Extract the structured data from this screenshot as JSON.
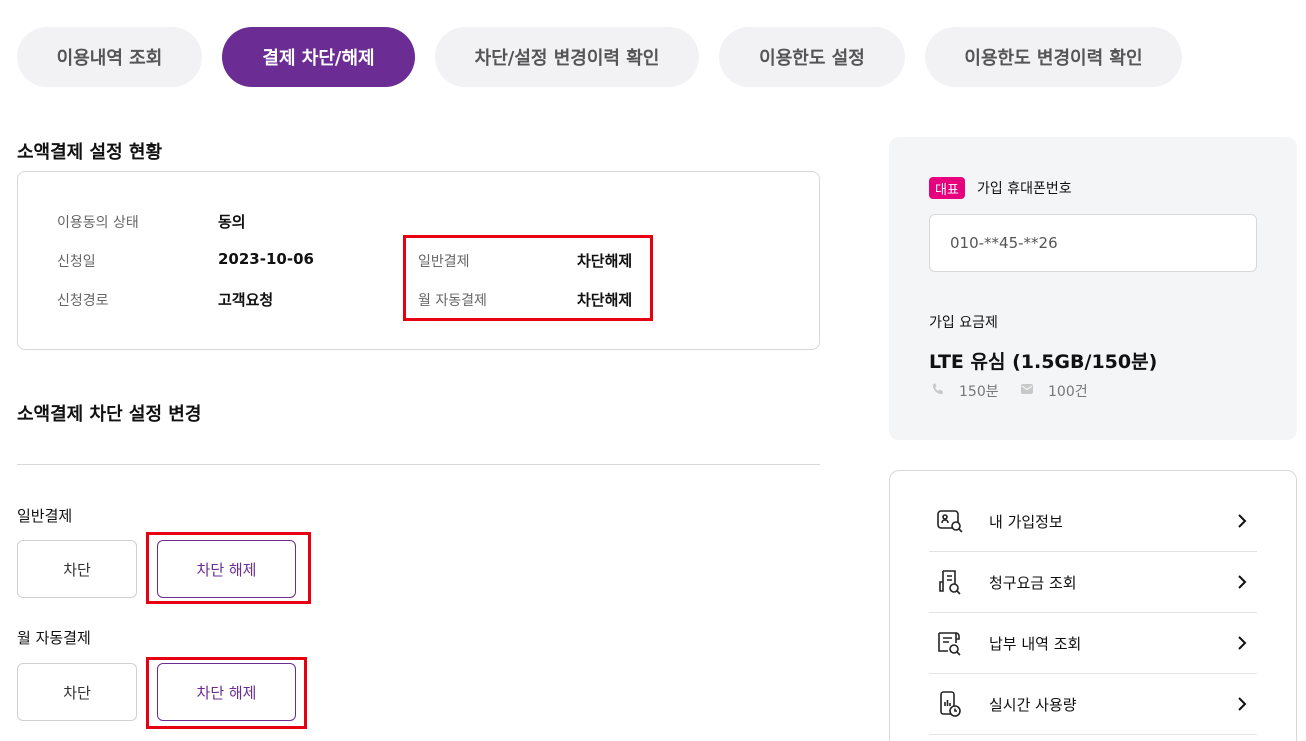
{
  "tabs": [
    {
      "label": "이용내역 조회"
    },
    {
      "label": "결제 차단/해제"
    },
    {
      "label": "차단/설정 변경이력 확인"
    },
    {
      "label": "이용한도 설정"
    },
    {
      "label": "이용한도 변경이력 확인"
    }
  ],
  "status": {
    "title": "소액결제 설정 현황",
    "consent_label": "이용동의 상태",
    "consent_value": "동의",
    "apply_date_label": "신청일",
    "apply_date_value": "2023-10-06",
    "apply_route_label": "신청경로",
    "apply_route_value": "고객요청",
    "general_label": "일반결제",
    "general_value": "차단해제",
    "monthly_label": "월 자동결제",
    "monthly_value": "차단해제"
  },
  "change": {
    "title": "소액결제 차단 설정 변경",
    "general_label": "일반결제",
    "monthly_label": "월 자동결제",
    "block_label": "차단",
    "unblock_label": "차단 해제"
  },
  "account": {
    "badge": "대표",
    "phone_label": "가입 휴대폰번호",
    "phone_value": "010-**45-**26",
    "plan_label": "가입 요금제",
    "plan_name": "LTE 유심 (1.5GB/150분)",
    "voice": "150분",
    "sms": "100건"
  },
  "menu": [
    {
      "label": "내 가입정보",
      "icon": "profile-search-icon"
    },
    {
      "label": "청구요금 조회",
      "icon": "bill-search-icon"
    },
    {
      "label": "납부 내역 조회",
      "icon": "receipt-search-icon"
    },
    {
      "label": "실시간 사용량",
      "icon": "phone-clock-icon"
    }
  ],
  "colors": {
    "accent": "#6b2c94",
    "highlight": "#e60012",
    "badge": "#e6007e"
  }
}
